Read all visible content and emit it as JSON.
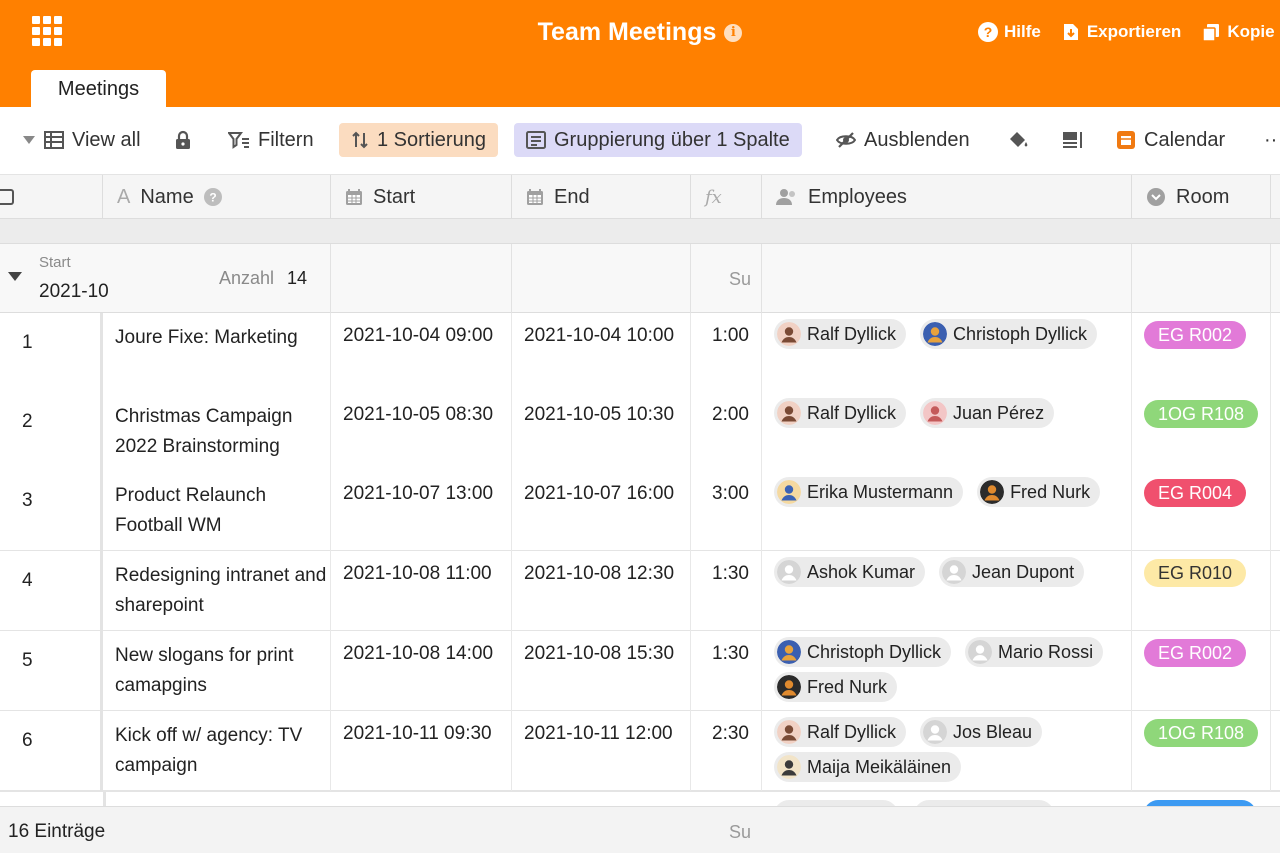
{
  "header": {
    "title": "Team Meetings",
    "info": "i",
    "actions": [
      "Hilfe",
      "Exportieren",
      "Kopie"
    ]
  },
  "tabs": [
    "Meetings"
  ],
  "toolbar": {
    "view": "View all",
    "filter": "Filtern",
    "sort": "1 Sortierung",
    "group": "Gruppierung über 1 Spalte",
    "hide": "Ausblenden",
    "calendar": "Calendar",
    "more": "··"
  },
  "columns": {
    "name": "Name",
    "start": "Start",
    "end": "End",
    "formula": "fx",
    "employees": "Employees",
    "room": "Room"
  },
  "group": {
    "label": "Start",
    "value": "2021-10",
    "count_label": "Anzahl",
    "count": "14",
    "summary": "Su"
  },
  "rows": [
    {
      "idx": "1",
      "name": "Joure Fixe: Marketing",
      "start": "2021-10-04 09:00",
      "end": "2021-10-04 10:00",
      "duration": "1:00",
      "employees": [
        "Ralf Dyllick",
        "Christoph Dyllick"
      ],
      "room": "EG R002"
    },
    {
      "idx": "2",
      "name": "Christmas Campaign 2022 Brainstorming",
      "start": "2021-10-05 08:30",
      "end": "2021-10-05 10:30",
      "duration": "2:00",
      "employees": [
        "Ralf Dyllick",
        "Juan Pérez"
      ],
      "room": "1OG R108"
    },
    {
      "idx": "3",
      "name": "Product Relaunch Football WM",
      "start": "2021-10-07 13:00",
      "end": "2021-10-07 16:00",
      "duration": "3:00",
      "employees": [
        "Erika Mustermann",
        "Fred Nurk"
      ],
      "room": "EG R004"
    },
    {
      "idx": "4",
      "name": "Redesigning intranet and sharepoint",
      "start": "2021-10-08 11:00",
      "end": "2021-10-08 12:30",
      "duration": "1:30",
      "employees": [
        "Ashok Kumar",
        "Jean Dupont"
      ],
      "room": "EG R010"
    },
    {
      "idx": "5",
      "name": "New slogans for print camapgins",
      "start": "2021-10-08 14:00",
      "end": "2021-10-08 15:30",
      "duration": "1:30",
      "employees": [
        "Christoph Dyllick",
        "Mario Rossi",
        "Fred Nurk"
      ],
      "room": "EG R002"
    },
    {
      "idx": "6",
      "name": "Kick off w/ agency: TV campaign",
      "start": "2021-10-11 09:30",
      "end": "2021-10-11 12:00",
      "duration": "2:30",
      "employees": [
        "Ralf Dyllick",
        "Jos Bleau",
        "Maija Meikäläinen"
      ],
      "room": "1OG R108"
    }
  ],
  "room_colors": {
    "EG R002": "#e27ad8",
    "1OG R108": "#8fd77a",
    "EG R004": "#f0506e",
    "EG R010": "#fde9a6"
  },
  "footer": {
    "count": "16 Einträge",
    "summary": "Su"
  }
}
